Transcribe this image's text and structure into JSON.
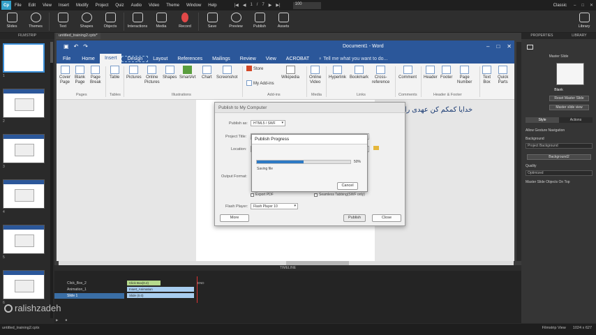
{
  "app": {
    "logo": "Cp",
    "menu": [
      "File",
      "Edit",
      "View",
      "Insert",
      "Modify",
      "Project",
      "Quiz",
      "Audio",
      "Video",
      "Theme",
      "Window",
      "Help"
    ],
    "page_current": "1",
    "page_sep": "/",
    "page_total": "7",
    "zoom": "100",
    "user": "Classic",
    "win_buttons": [
      "–",
      "□",
      "✕"
    ]
  },
  "toolbar": {
    "items": [
      {
        "label": "Slides",
        "icon": "slides-icon"
      },
      {
        "label": "Themes",
        "icon": "themes-icon"
      },
      {
        "label": "Text",
        "icon": "text-icon"
      },
      {
        "label": "Shapes",
        "icon": "shapes-icon"
      },
      {
        "label": "Objects",
        "icon": "objects-icon"
      },
      {
        "label": "Interactions",
        "icon": "interactions-icon"
      },
      {
        "label": "Media",
        "icon": "media-icon"
      },
      {
        "label": "Record",
        "icon": "record-icon"
      },
      {
        "label": "Save",
        "icon": "save-icon"
      },
      {
        "label": "Preview",
        "icon": "preview-icon"
      },
      {
        "label": "Publish",
        "icon": "publish-icon"
      },
      {
        "label": "Assets",
        "icon": "assets-icon"
      },
      {
        "label": "Library",
        "icon": "library-icon"
      }
    ]
  },
  "filmstrip": {
    "title": "FILMSTRIP",
    "numbers": [
      "1",
      "2",
      "3",
      "4",
      "5",
      "6"
    ]
  },
  "stage": {
    "tab": "untitled_training2.cptx*"
  },
  "word": {
    "doc_title": "Document1 - Word",
    "tabs": [
      "File",
      "Home",
      "Insert",
      "Design",
      "Layout",
      "References",
      "Mailings",
      "Review",
      "View",
      "ACROBAT"
    ],
    "active_tab": "Insert",
    "tell_me": "♀ Tell me what you want to do...",
    "ribbon": {
      "cover_page": "Cover\nPage",
      "blank_page": "Blank\nPage",
      "page_break": "Page\nBreak",
      "table": "Table",
      "pictures": "Pictures",
      "online_pictures": "Online\nPictures",
      "shapes": "Shapes",
      "smartart": "SmartArt",
      "chart": "Chart",
      "screenshot": "Screenshot",
      "store": "Store",
      "my_addins": "My Add-ins",
      "wikipedia": "Wikipedia",
      "online_video": "Online\nVideo",
      "hyperlink": "Hyperlink",
      "bookmark": "Bookmark",
      "cross_reference": "Cross-\nreference",
      "comment": "Comment",
      "header": "Header",
      "footer": "Footer",
      "page_number": "Page\nNumber",
      "text_box": "Text\nBox",
      "quick_parts": "Quick\nParts"
    },
    "groups": [
      "Pages",
      "Tables",
      "Illustrations",
      "Add-ins",
      "Media",
      "Links",
      "Comments",
      "Header & Footer"
    ],
    "body_text": "خدایا کمکم کن عهدی را ک"
  },
  "publish_dialog": {
    "title": "Publish to My Computer",
    "publish_as_label": "Publish as:",
    "publish_as_value": "HTML5 / SWF",
    "project_title_label": "Project Title:",
    "location_label": "Location:",
    "output_format_label": "Output Format:",
    "export_pdf": "Export PDF",
    "seamless_tabbing": "Seamless Tabbing(SWF only)",
    "flash_player_label": "Flash Player:",
    "flash_player_value": "Flash Player 10",
    "more_button": "More",
    "publish_button": "Publish",
    "close_button": "Close"
  },
  "progress_dialog": {
    "title": "Publish Progress",
    "percent_text": "50%",
    "progress": 0.5,
    "status": "Saving file",
    "cancel_button": "Cancel"
  },
  "properties": {
    "tabs": [
      "PROPERTIES",
      "LIBRARY"
    ],
    "master_slide_heading": "Master Slide",
    "blank_label": "Blank",
    "reset_button": "Reset Master Slide",
    "master_view_button": "Master slide view",
    "panel_tabs": [
      "Style",
      "Actions"
    ],
    "allow_gesture": "Allow Gesture Navigation",
    "background_label": "Background",
    "background_value": "Project Background",
    "background2": "Background2",
    "quality_label": "Quality",
    "quality_value": "Optimized",
    "master_objects": "Master Slide Objects On Top"
  },
  "timeline": {
    "title": "TIMELINE",
    "rows": [
      "Click_Box_2",
      "Animation_1",
      "Slide 1"
    ],
    "bars": [
      "Click Box(0.2)",
      "Insert_Animation",
      "Slide (0.0)"
    ],
    "ruler": [
      "00:00",
      "00:01",
      "00:02",
      "00:03",
      "00:04",
      "00:05",
      "00:06",
      "00:07",
      "00:08",
      "00:09",
      "00:10",
      "00:11",
      "00:12",
      "00:13",
      "00:14",
      "00:15",
      "00:16"
    ],
    "end_label": "END"
  },
  "statusbar": {
    "file": "untitled_training2.cptx",
    "view": "Filmstrip View",
    "dims": "1024 x 627"
  },
  "watermark": "ralishzadeh"
}
